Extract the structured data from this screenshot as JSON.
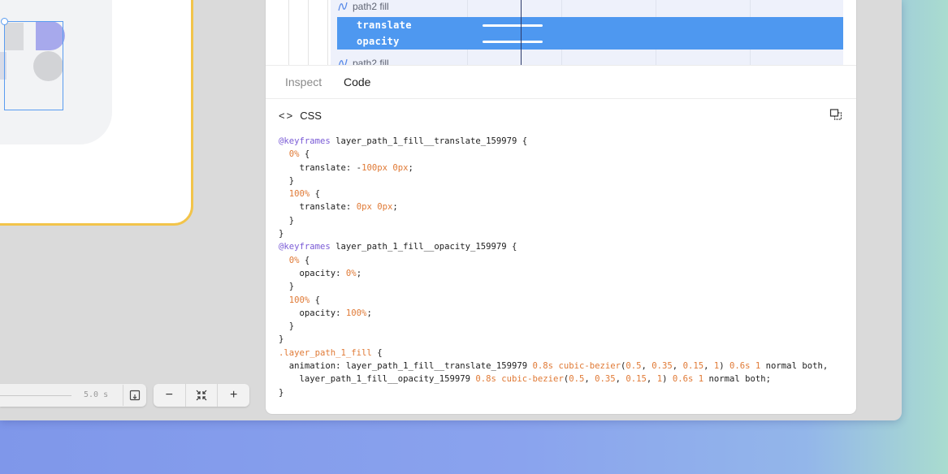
{
  "timeline": {
    "layer_above": "path2 fill",
    "selected_properties": [
      "translate",
      "opacity"
    ],
    "layer_below": "path2 fill"
  },
  "playback": {
    "duration": "5.0 s"
  },
  "zoom": {
    "minus": "−",
    "plus": "+"
  },
  "tabs": {
    "inspect": "Inspect",
    "code": "Code"
  },
  "code_header": {
    "glyph": "<>",
    "label": "CSS"
  },
  "css": {
    "kf1_at": "@keyframes",
    "kf1_name": " layer_path_1_fill__translate_159979 {",
    "kf1_0_pct": "0%",
    "kf1_0_decl_prop": "translate: -",
    "kf1_0_decl_v1": "100px",
    "kf1_0_decl_v2": "0px",
    "kf1_100_pct": "100%",
    "kf1_100_decl_prop": "translate: ",
    "kf1_100_decl_v1": "0px",
    "kf1_100_decl_v2": "0px",
    "kf2_at": "@keyframes",
    "kf2_name": " layer_path_1_fill__opacity_159979 {",
    "kf2_0_pct": "0%",
    "kf2_0_decl_prop": "opacity: ",
    "kf2_0_decl_v": "0%",
    "kf2_100_pct": "100%",
    "kf2_100_decl_prop": "opacity: ",
    "kf2_100_decl_v": "100%",
    "selector": ".layer_path_1_fill",
    "anim_prop": "animation: layer_path_1_fill__translate_159979 ",
    "anim1_dur": "0.8s",
    "anim1_fn": "cubic-bezier",
    "anim1_a": "0.5",
    "anim1_b": "0.35",
    "anim1_c": "0.15",
    "anim1_d": "1",
    "anim1_delay": "0.6s",
    "anim1_iter": "1",
    "anim1_tail": " normal both,",
    "anim2_name": "layer_path_1_fill__opacity_159979 ",
    "anim2_dur": "0.8s",
    "anim2_fn": "cubic-bezier",
    "anim2_a": "0.5",
    "anim2_b": "0.35",
    "anim2_c": "0.15",
    "anim2_d": "1",
    "anim2_delay": "0.6s",
    "anim2_iter": "1",
    "anim2_tail": " normal both;"
  }
}
